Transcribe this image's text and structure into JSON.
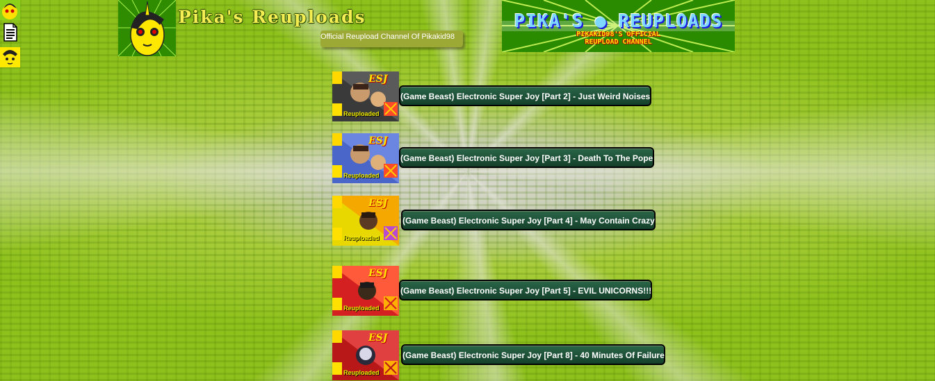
{
  "site": {
    "title": "Pika's Reuploads",
    "subtitle": "Official Reupload Channel Of Pikakid98"
  },
  "banner": {
    "title": "PIKA'S ● REUPLOADS",
    "subtitle_line1": "PIKAKID98'S OFFICIAL",
    "subtitle_line2": "REUPLOAD CHANNEL"
  },
  "nav": {
    "icons": [
      "pony-avatar-icon",
      "document-icon",
      "pony-face-icon"
    ]
  },
  "videos": [
    {
      "title": "(Game Beast) Electronic Super Joy [Part 2] - Just Weird Noises",
      "thumb_label": "Reuploaded",
      "thumb_mark": "ESJ",
      "thumb_color": "#3a3a3a"
    },
    {
      "title": "(Game Beast) Electronic Super Joy [Part 3] - Death To The Pope",
      "thumb_label": "Reuploaded",
      "thumb_mark": "ESJ",
      "thumb_color": "#4a66c8"
    },
    {
      "title": "(Game Beast) Electronic Super Joy [Part 4] - May Contain Crazy",
      "thumb_label": "Reuploaded",
      "thumb_mark": "ESJ",
      "thumb_color": "#e8d800"
    },
    {
      "title": "(Game Beast) Electronic Super Joy [Part 5] - EVIL UNICORNS!!!",
      "thumb_label": "Reuploaded",
      "thumb_mark": "ESJ",
      "thumb_color": "#d42020"
    },
    {
      "title": "(Game Beast) Electronic Super Joy [Part 8] - 40 Minutes Of Failure",
      "thumb_label": "Reuploaded",
      "thumb_mark": "ESJ",
      "thumb_color": "#b81818"
    }
  ],
  "colors": {
    "background_green": "#8fc11c",
    "title_yellow": "#f4ee52",
    "button_green": "#1e5538"
  }
}
